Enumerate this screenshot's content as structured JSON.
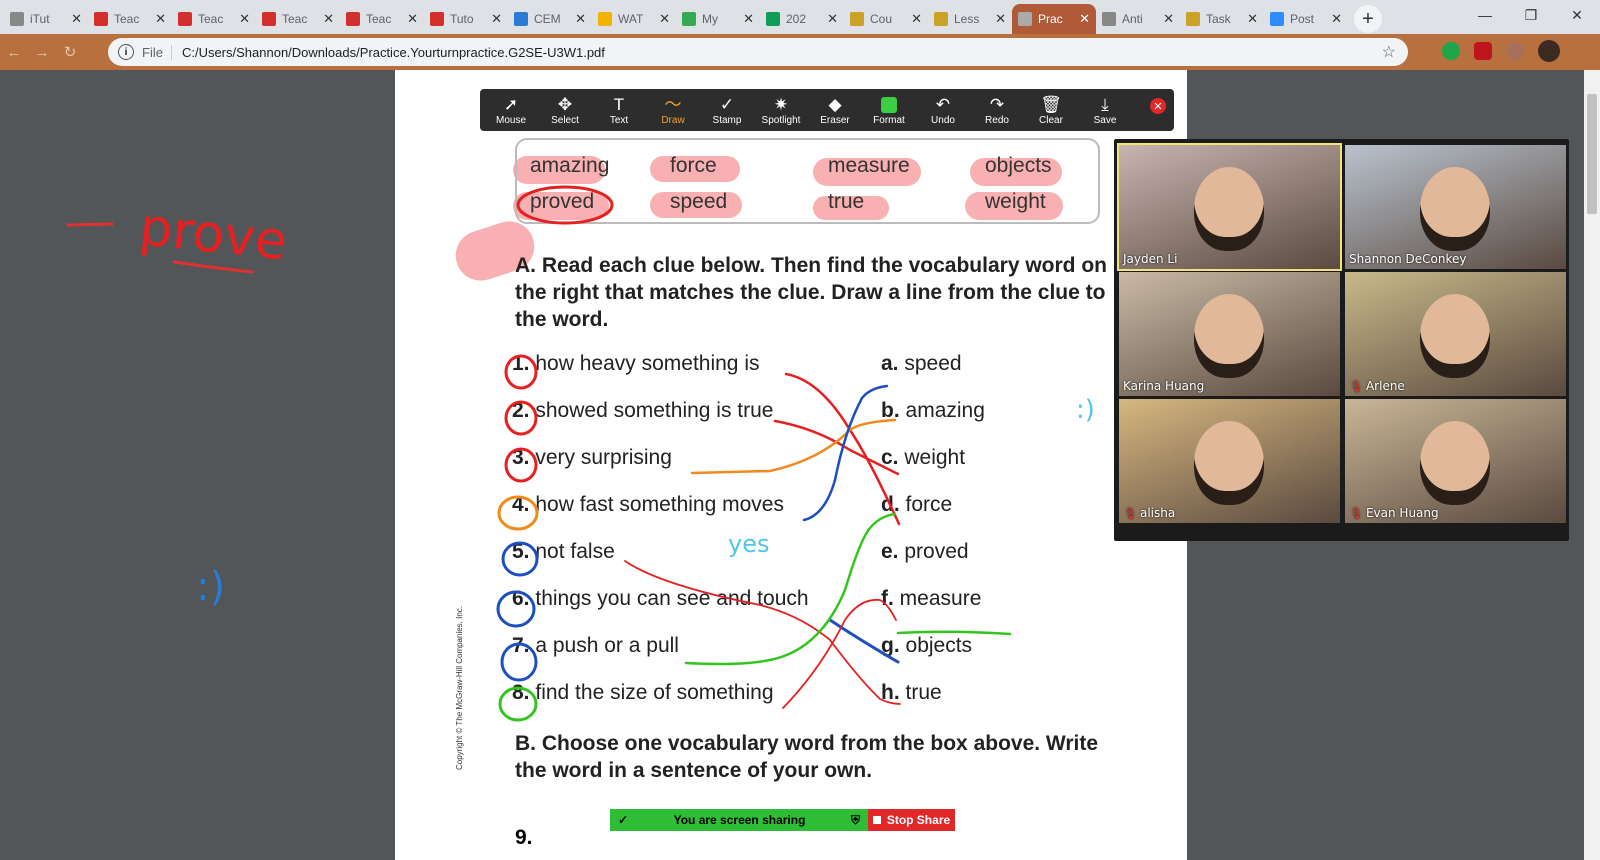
{
  "browser": {
    "tabs": [
      {
        "title": "iTut",
        "icon": "globe-icon",
        "color": "#888888"
      },
      {
        "title": "Teac",
        "icon": "teacher-doc-icon",
        "color": "#d32f2f"
      },
      {
        "title": "Teac",
        "icon": "teacher-doc-icon",
        "color": "#d32f2f"
      },
      {
        "title": "Teac",
        "icon": "teacher-doc-icon",
        "color": "#d32f2f"
      },
      {
        "title": "Teac",
        "icon": "teacher-doc-icon",
        "color": "#d32f2f"
      },
      {
        "title": "Tuto",
        "icon": "teacher-doc-icon",
        "color": "#d32f2f"
      },
      {
        "title": "CEM",
        "icon": "diamond-icon",
        "color": "#2a7bd4"
      },
      {
        "title": "WAT",
        "icon": "dot-icon",
        "color": "#f0b400"
      },
      {
        "title": "My",
        "icon": "drive-icon",
        "color": "#34a853"
      },
      {
        "title": "202",
        "icon": "sheets-icon",
        "color": "#0f9d58"
      },
      {
        "title": "Cou",
        "icon": "classroom-icon",
        "color": "#c9a227"
      },
      {
        "title": "Less",
        "icon": "classroom-icon",
        "color": "#c9a227"
      },
      {
        "title": "Prac",
        "icon": "globe-icon",
        "color": "#aaaaaa"
      },
      {
        "title": "Anti",
        "icon": "globe-icon",
        "color": "#888888"
      },
      {
        "title": "Task",
        "icon": "classroom-icon",
        "color": "#c9a227"
      },
      {
        "title": "Post",
        "icon": "zoom-icon",
        "color": "#2d8cff"
      }
    ],
    "active_tab_index": 12,
    "file_label": "File",
    "url": "C:/Users/Shannon/Downloads/Practice.Yourturnpractice.G2SE-U3W1.pdf"
  },
  "annotation_toolbar": {
    "tools": [
      {
        "label": "Mouse",
        "icon": "cursor-icon",
        "glyph": "➚"
      },
      {
        "label": "Select",
        "icon": "move-icon",
        "glyph": "✥"
      },
      {
        "label": "Text",
        "icon": "text-icon",
        "glyph": "T"
      },
      {
        "label": "Draw",
        "icon": "draw-icon",
        "glyph": "〜"
      },
      {
        "label": "Stamp",
        "icon": "stamp-icon",
        "glyph": "✓"
      },
      {
        "label": "Spotlight",
        "icon": "spotlight-icon",
        "glyph": "✷"
      },
      {
        "label": "Eraser",
        "icon": "eraser-icon",
        "glyph": "◆"
      },
      {
        "label": "Format",
        "icon": "format-icon",
        "glyph": ""
      },
      {
        "label": "Undo",
        "icon": "undo-icon",
        "glyph": "↶"
      },
      {
        "label": "Redo",
        "icon": "redo-icon",
        "glyph": "↷"
      },
      {
        "label": "Clear",
        "icon": "trash-icon",
        "glyph": "🗑"
      },
      {
        "label": "Save",
        "icon": "save-icon",
        "glyph": "⤓"
      }
    ],
    "active_tool": "Draw"
  },
  "worksheet": {
    "word_box": [
      "amazing",
      "force",
      "measure",
      "objects",
      "proved",
      "speed",
      "true",
      "weight"
    ],
    "section_a": "A. Read each clue below. Then find the vocabulary word on the right that matches the clue. Draw a line from the clue to the word.",
    "clues": [
      {
        "num": "1.",
        "text": "how heavy something is"
      },
      {
        "num": "2.",
        "text": "showed something is true"
      },
      {
        "num": "3.",
        "text": "very surprising"
      },
      {
        "num": "4.",
        "text": "how fast something moves"
      },
      {
        "num": "5.",
        "text": "not false"
      },
      {
        "num": "6.",
        "text": "things you can see and touch"
      },
      {
        "num": "7.",
        "text": "a push or a pull"
      },
      {
        "num": "8.",
        "text": "find the size of something"
      }
    ],
    "answers": [
      {
        "letter": "a.",
        "word": "speed"
      },
      {
        "letter": "b.",
        "word": "amazing"
      },
      {
        "letter": "c.",
        "word": "weight"
      },
      {
        "letter": "d.",
        "word": "force"
      },
      {
        "letter": "e.",
        "word": "proved"
      },
      {
        "letter": "f.",
        "word": "measure"
      },
      {
        "letter": "g.",
        "word": "objects"
      },
      {
        "letter": "h.",
        "word": "true"
      }
    ],
    "section_b": "B. Choose one vocabulary word from the box above. Write the word in a sentence of your own.",
    "question_9": "9.",
    "copyright": "Copyright © The McGraw-Hill Companies, Inc."
  },
  "handwriting": {
    "prove_text": "prove",
    "yes_text": "yes",
    "smiley_left": ":)",
    "smiley_right": ":)"
  },
  "participants": [
    {
      "name": "Jayden Li",
      "muted": false,
      "bg": "#c8b4b0"
    },
    {
      "name": "Shannon DeConkey",
      "muted": false,
      "bg": "#b9c3cf"
    },
    {
      "name": "Karina Huang",
      "muted": false,
      "bg": "#c9b9a5"
    },
    {
      "name": "Arlene",
      "muted": true,
      "bg": "#c8b98a"
    },
    {
      "name": "alisha",
      "muted": true,
      "bg": "#d7b780"
    },
    {
      "name": "Evan Huang",
      "muted": true,
      "bg": "#c9b697"
    }
  ],
  "share_bar": {
    "status": "You are screen sharing",
    "stop_label": "Stop Share"
  }
}
